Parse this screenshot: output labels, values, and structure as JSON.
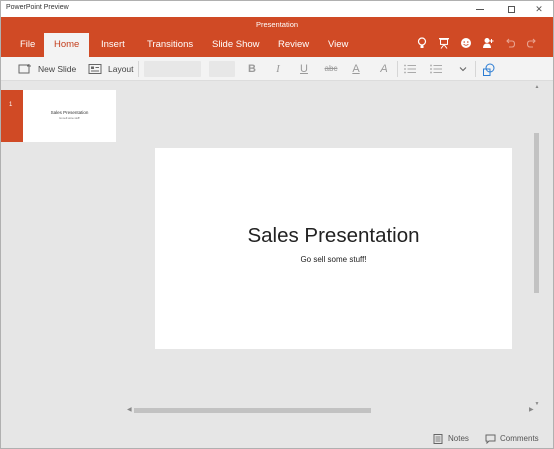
{
  "window": {
    "title": "PowerPoint Preview",
    "controls": {
      "minimize": "",
      "maximize": "",
      "close": "✕"
    }
  },
  "app_bar": {
    "doc_title": "Presentation",
    "tabs": [
      {
        "label": "File"
      },
      {
        "label": "Home",
        "active": true
      },
      {
        "label": "Insert"
      },
      {
        "label": "Transitions"
      },
      {
        "label": "Slide Show"
      },
      {
        "label": "Review"
      },
      {
        "label": "View"
      }
    ],
    "icons": [
      "lightbulb-icon",
      "present-icon",
      "smiley-icon",
      "share-icon",
      "undo-icon",
      "redo-icon"
    ]
  },
  "ribbon": {
    "new_slide_label": "New Slide",
    "layout_label": "Layout",
    "font_name": "",
    "font_size": "",
    "bold": "B",
    "italic": "I",
    "underline": "U",
    "strike": "abc",
    "font_color": "A",
    "clear": "A"
  },
  "slide_panel": {
    "slides": [
      {
        "number": "1",
        "title": "Sales Presentation",
        "subtitle": "Go sell some stuff!"
      }
    ]
  },
  "canvas": {
    "title": "Sales Presentation",
    "subtitle": "Go sell some stuff!"
  },
  "status_bar": {
    "notes_label": "Notes",
    "comments_label": "Comments"
  },
  "colors": {
    "accent": "#d04a25",
    "ribbon_bg": "#f3f3f3",
    "canvas_bg": "#e6e6e6"
  }
}
